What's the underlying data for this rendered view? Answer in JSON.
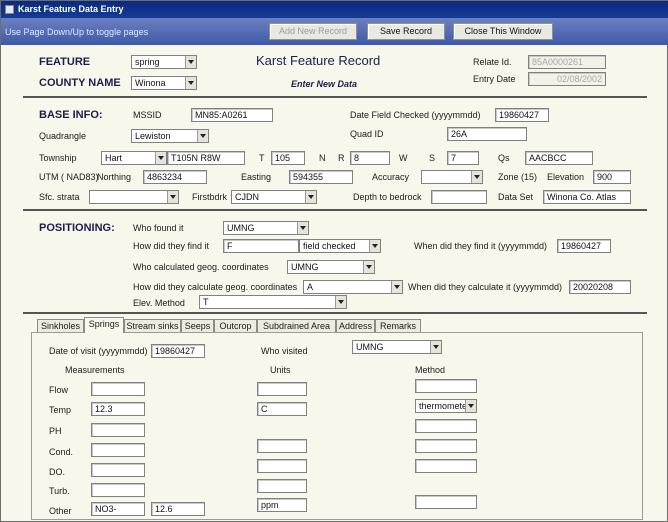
{
  "window": {
    "title": "Karst Feature Data Entry"
  },
  "toolbar": {
    "hint": "Use Page Down/Up to toggle pages",
    "add_record": "Add New Record",
    "save_record": "Save Record",
    "close_window": "Close This Window"
  },
  "header": {
    "feature_label": "FEATURE",
    "feature_value": "spring",
    "county_label": "COUNTY NAME",
    "county_value": "Winona",
    "form_title": "Karst Feature Record",
    "enter_new_data": "Enter New Data",
    "relate_id_label": "Relate Id.",
    "relate_id_value": "85A0000261",
    "entry_date_label": "Entry Date",
    "entry_date_value": "02/08/2002"
  },
  "base_info": {
    "section_label": "BASE INFO:",
    "mssid_label": "MSSID",
    "mssid_value": "MN85:A0261",
    "date_checked_label": "Date Field Checked (yyyymmdd)",
    "date_checked_value": "19860427",
    "quadrangle_label": "Quadrangle",
    "quadrangle_value": "Lewiston",
    "quad_id_label": "Quad ID",
    "quad_id_value": "26A",
    "township_label": "Township",
    "township_value": "Hart",
    "t105_value": "T105N R8W",
    "t_label": "T",
    "t_value": "105",
    "n_label": "N",
    "r_label": "R",
    "r_value": "8",
    "w_label": "W",
    "s_label": "S",
    "s_value": "7",
    "qs_label": "Qs",
    "qs_value": "AACBCC",
    "utm_label": "UTM ( NAD83)",
    "northing_label": "Northing",
    "northing_value": "4863234",
    "easting_label": "Easting",
    "easting_value": "594355",
    "accuracy_label": "Accuracy",
    "accuracy_value": "",
    "zone_label": "Zone (15)",
    "elevation_label": "Elevation",
    "elevation_value": "900",
    "sfc_strata_label": "Sfc. strata",
    "sfc_strata_value": "",
    "firstbdrk_label": "Firstbdrk",
    "firstbdrk_value": "CJDN",
    "depth_label": "Depth to bedrock",
    "depth_value": "",
    "dataset_label": "Data Set",
    "dataset_value": "Winona Co. Atlas"
  },
  "positioning": {
    "section_label": "POSITIONING:",
    "who_found_label": "Who found it",
    "who_found_value": "UMNG",
    "how_find_label": "How did they find it",
    "how_find_code": "F",
    "how_find_value": "field checked",
    "when_find_label": "When did they find it (yyyymmdd)",
    "when_find_value": "19860427",
    "who_calc_label": "Who calculated geog. coordinates",
    "who_calc_value": "UMNG",
    "how_calc_label": "How did they calculate geog. coordinates",
    "how_calc_value": "A",
    "when_calc_label": "When did they calculate it (yyyymmdd)",
    "when_calc_value": "20020208",
    "elev_method_label": "Elev. Method",
    "elev_method_value": "T"
  },
  "tabs": [
    "Sinkholes",
    "Springs",
    "Stream sinks",
    "Seeps",
    "Outcrop",
    "Subdrained Area",
    "Address",
    "Remarks"
  ],
  "springs": {
    "visit_date_label": "Date of visit (yyyymmdd)",
    "visit_date_value": "19860427",
    "who_visited_label": "Who visited",
    "who_visited_value": "UMNG",
    "measurements_header": "Measurements",
    "units_header": "Units",
    "method_header": "Method",
    "rows": [
      {
        "label": "Flow",
        "value": "",
        "units": "",
        "method": ""
      },
      {
        "label": "Temp",
        "value": "12.3",
        "units": "C",
        "method": "thermomete"
      },
      {
        "label": "PH",
        "value": "",
        "units": "",
        "method": ""
      },
      {
        "label": "Cond.",
        "value": "",
        "units": "",
        "method": ""
      },
      {
        "label": "DO.",
        "value": "",
        "units": "",
        "method": ""
      },
      {
        "label": "Turb.",
        "value": "",
        "units": "",
        "method": ""
      },
      {
        "label": "Other",
        "value": "NO3-",
        "value2": "12.6",
        "units": "ppm",
        "method": ""
      }
    ]
  }
}
